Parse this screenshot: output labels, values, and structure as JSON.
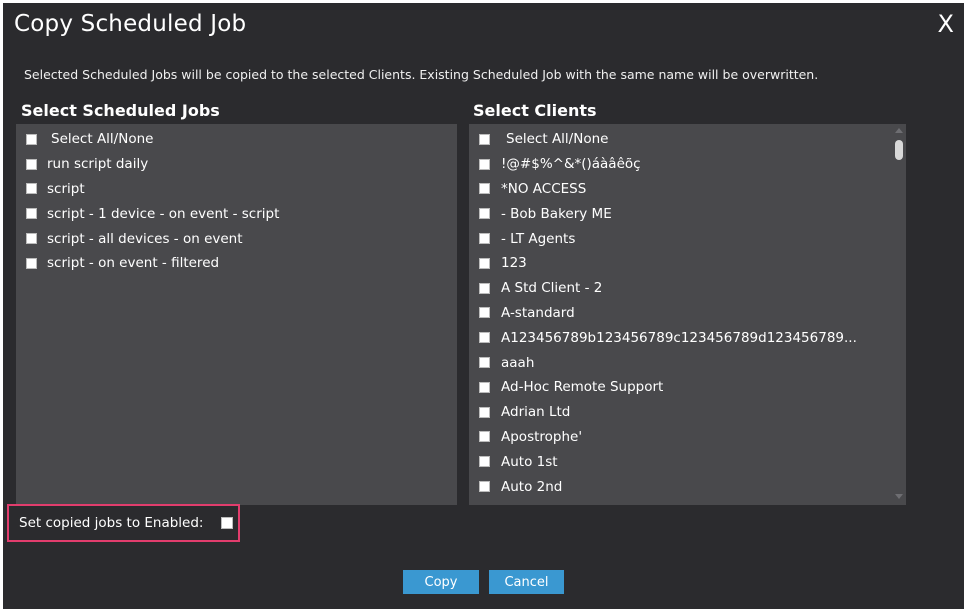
{
  "dialog": {
    "title": "Copy Scheduled Job",
    "close_label": "X",
    "description": "Selected Scheduled Jobs will be copied to the selected Clients. Existing Scheduled Job with the same name will be overwritten."
  },
  "jobs": {
    "heading": "Select Scheduled Jobs",
    "select_all_label": "Select All/None",
    "items": [
      "run script daily",
      "script",
      "script - 1 device - on event - script",
      "script - all devices - on event",
      "script - on event - filtered"
    ]
  },
  "clients": {
    "heading": "Select Clients",
    "select_all_label": "Select All/None",
    "items": [
      "!@#$%^&*()áàâêõç",
      "*NO ACCESS",
      "- Bob Bakery ME",
      "- LT Agents",
      "123",
      "A Std Client - 2",
      "A-standard",
      "A123456789b123456789c123456789d123456789...",
      "aaah",
      "Ad-Hoc Remote Support",
      "Adrian Ltd",
      "Apostrophe'",
      "Auto 1st",
      "Auto 2nd"
    ]
  },
  "options": {
    "enabled_label": "Set copied jobs to Enabled:"
  },
  "buttons": {
    "copy_label": "Copy",
    "cancel_label": "Cancel"
  },
  "colors": {
    "dialog_bg": "#2b2b2e",
    "panel_bg": "#49494c",
    "button_blue": "#3a98d1",
    "highlight_pink": "#e23d6d"
  }
}
